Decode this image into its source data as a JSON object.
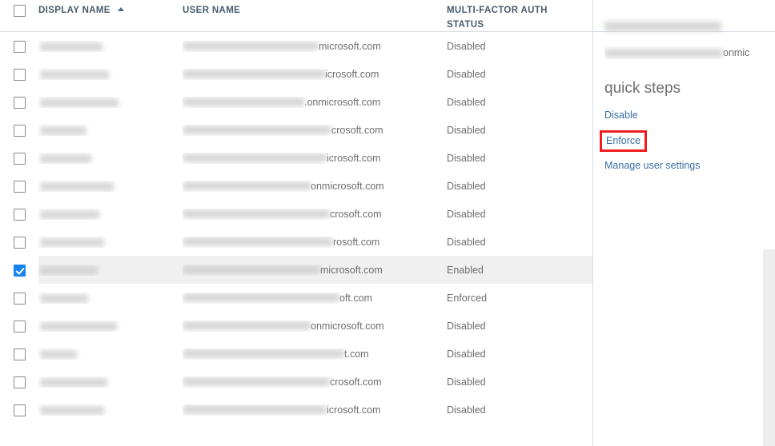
{
  "table": {
    "columns": [
      {
        "key": "display_name",
        "label": "DISPLAY NAME",
        "sorted": "asc",
        "sort_icon": "caret-up-icon"
      },
      {
        "key": "user_name",
        "label": "USER NAME"
      },
      {
        "key": "mfa_status",
        "label": "MULTI-FACTOR AUTH STATUS",
        "line1": "MULTI-FACTOR AUTH",
        "line2": "STATUS"
      }
    ],
    "header_checkbox": {
      "checked": false,
      "name": "select-all-checkbox"
    },
    "rows": [
      {
        "display_name": "",
        "display_name_redacted": true,
        "display_name_width": 78,
        "user_name_redacted": true,
        "user_name_width": 170,
        "user_name_suffix": "microsoft.com",
        "mfa_status": "Disabled",
        "selected": false
      },
      {
        "display_name": "",
        "display_name_redacted": true,
        "display_name_width": 86,
        "user_name_redacted": true,
        "user_name_width": 178,
        "user_name_suffix": "icrosoft.com",
        "mfa_status": "Disabled",
        "selected": false
      },
      {
        "display_name": "",
        "display_name_redacted": true,
        "display_name_width": 98,
        "user_name_redacted": true,
        "user_name_width": 152,
        "user_name_suffix": ".onmicrosoft.com",
        "mfa_status": "Disabled",
        "selected": false
      },
      {
        "display_name": "",
        "display_name_redacted": true,
        "display_name_width": 58,
        "user_name_redacted": true,
        "user_name_width": 186,
        "user_name_suffix": "crosoft.com",
        "mfa_status": "Disabled",
        "selected": false
      },
      {
        "display_name": "",
        "display_name_redacted": true,
        "display_name_width": 64,
        "user_name_redacted": true,
        "user_name_width": 180,
        "user_name_suffix": "icrosoft.com",
        "mfa_status": "Disabled",
        "selected": false
      },
      {
        "display_name": "",
        "display_name_redacted": true,
        "display_name_width": 92,
        "user_name_redacted": true,
        "user_name_width": 160,
        "user_name_suffix": "onmicrosoft.com",
        "mfa_status": "Disabled",
        "selected": false
      },
      {
        "display_name": "",
        "display_name_redacted": true,
        "display_name_width": 74,
        "user_name_redacted": true,
        "user_name_width": 184,
        "user_name_suffix": "crosoft.com",
        "mfa_status": "Disabled",
        "selected": false
      },
      {
        "display_name": "",
        "display_name_redacted": true,
        "display_name_width": 80,
        "user_name_redacted": true,
        "user_name_width": 188,
        "user_name_suffix": "rosoft.com",
        "mfa_status": "Disabled",
        "selected": false
      },
      {
        "display_name": "",
        "display_name_redacted": true,
        "display_name_width": 72,
        "user_name_redacted": true,
        "user_name_width": 172,
        "user_name_suffix": "microsoft.com",
        "mfa_status": "Enabled",
        "selected": true
      },
      {
        "display_name": "",
        "display_name_redacted": true,
        "display_name_width": 60,
        "user_name_redacted": true,
        "user_name_width": 196,
        "user_name_suffix": "oft.com",
        "mfa_status": "Enforced",
        "selected": false
      },
      {
        "display_name": "",
        "display_name_redacted": true,
        "display_name_width": 96,
        "user_name_redacted": true,
        "user_name_width": 160,
        "user_name_suffix": "onmicrosoft.com",
        "mfa_status": "Disabled",
        "selected": false
      },
      {
        "display_name": "",
        "display_name_redacted": true,
        "display_name_width": 46,
        "user_name_redacted": true,
        "user_name_width": 202,
        "user_name_suffix": "t.com",
        "mfa_status": "Disabled",
        "selected": false
      },
      {
        "display_name": "",
        "display_name_redacted": true,
        "display_name_width": 84,
        "user_name_redacted": true,
        "user_name_width": 184,
        "user_name_suffix": "crosoft.com",
        "mfa_status": "Disabled",
        "selected": false
      },
      {
        "display_name": "",
        "display_name_redacted": true,
        "display_name_width": 80,
        "user_name_redacted": true,
        "user_name_width": 180,
        "user_name_suffix": "icrosoft.com",
        "mfa_status": "Disabled",
        "selected": false
      }
    ]
  },
  "detail_panel": {
    "user_display_name_redacted": true,
    "user_display_name_width": 146,
    "user_email_redacted": true,
    "user_email_width": 148,
    "user_email_suffix": "onmic",
    "quick_steps_title": "quick steps",
    "links": [
      {
        "label": "Disable",
        "name": "disable-link",
        "highlighted": false
      },
      {
        "label": "Enforce",
        "name": "enforce-link",
        "highlighted": true
      },
      {
        "label": "Manage user settings",
        "name": "manage-user-settings-link",
        "highlighted": false
      }
    ]
  },
  "colors": {
    "accent_blue": "#1783ef",
    "link_blue": "#3b6ea5",
    "header_text": "#4a5b6b",
    "body_text": "#6d6d6d",
    "selected_row_bg": "#f0f0f0",
    "divider": "#d6dde3",
    "annotation_red": "#ee1c1c",
    "scrollbar_track": "#ededed"
  }
}
